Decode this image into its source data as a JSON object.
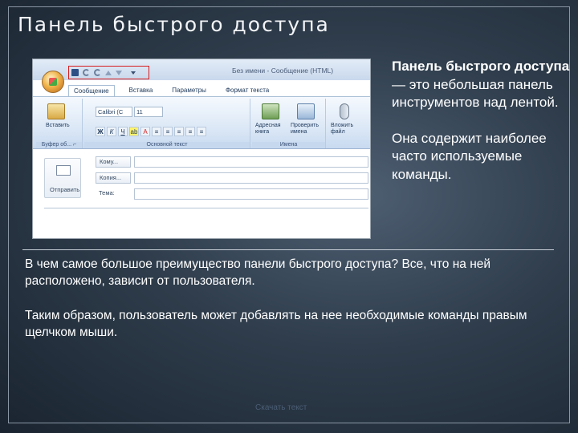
{
  "slide": {
    "title": "Панель быстрого доступа",
    "side_heading": "Панель быстрого доступа",
    "side_text1": " — это небольшая панель инструментов над лентой.",
    "side_text2": "Она содержит наиболее часто используемые команды.",
    "para1": "В чем самое большое преимущество панели быстрого доступа? Все, что на ней расположено, зависит от пользователя.",
    "para2": "Таким образом, пользователь может добавлять на нее необходимые команды правым щелчком мыши.",
    "footer": "Скачать текст"
  },
  "screenshot": {
    "window_title": "Без имени - Сообщение (HTML)",
    "tabs": [
      "Сообщение",
      "Вставка",
      "Параметры",
      "Формат текста"
    ],
    "clipboard_group": {
      "paste_label": "Вставить",
      "label": "Буфер об...",
      "launcher": "⌐"
    },
    "basic_text_group": {
      "font": "Calibri (С",
      "size": "11",
      "label": "Основной текст",
      "format_buttons": [
        "Ж",
        "К",
        "Ч",
        "ab",
        "A",
        "≡",
        "≡",
        "≡",
        "≡",
        "≡"
      ]
    },
    "names_group": {
      "address_book": "Адресная книга",
      "check_names": "Проверить имена",
      "label": "Имена"
    },
    "include_group": {
      "attach_label": "Вложить файл"
    },
    "send_label": "Отправить",
    "fields": [
      "Кому...",
      "Копия...",
      "Тема:"
    ],
    "qat_icons": [
      "save-icon",
      "undo-icon",
      "redo-icon",
      "up-icon",
      "down-icon",
      "customize-icon"
    ]
  }
}
